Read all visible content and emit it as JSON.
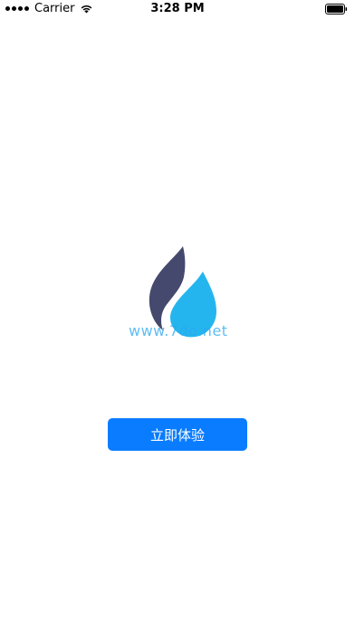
{
  "status_bar": {
    "carrier": "Carrier",
    "time": "3:28 PM",
    "wifi_icon": "wifi-icon",
    "battery_icon": "battery-icon"
  },
  "logo": {
    "icon": "flame-drop-logo",
    "watermark": "www.7do.net",
    "colors": {
      "dark": "#45496d",
      "light": "#25b5ee"
    }
  },
  "start_button": {
    "label": "立即体验",
    "color": "#0a7cff"
  }
}
